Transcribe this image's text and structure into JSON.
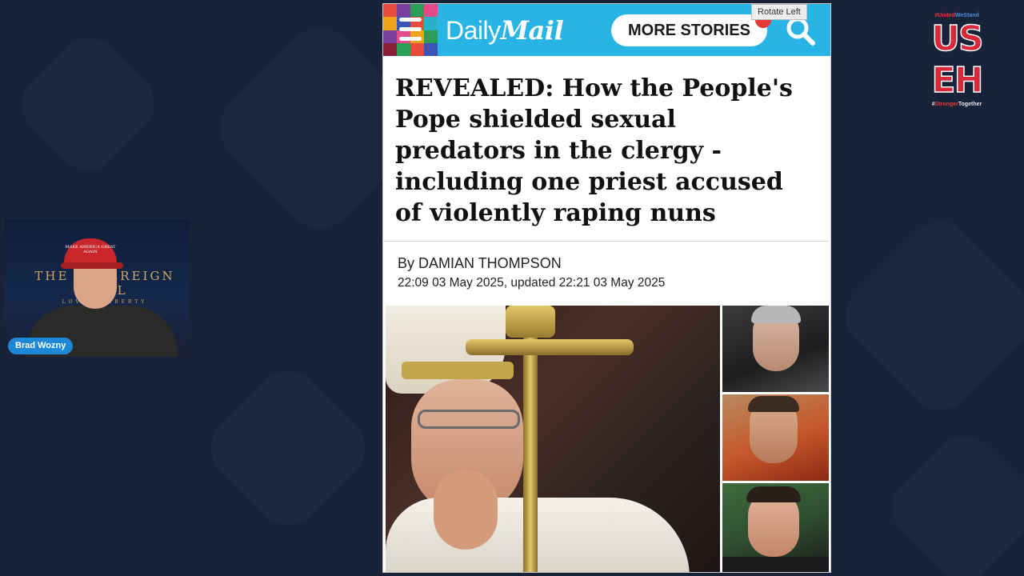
{
  "overlay": {
    "presenter_name": "Brad Wozny",
    "cam_logo": "THE SOVEREIGN SOUL",
    "cam_logo_sub": "LOVE · LIBERTY",
    "cap_text": "MAKE AMERICA GREAT AGAIN"
  },
  "tooltip": "Rotate Left",
  "header": {
    "logo_daily": "Daily",
    "logo_mail": "Mail",
    "more_stories": "MORE STORIES",
    "brand_color": "#29b4e6"
  },
  "article": {
    "headline": "REVEALED: How the People's Pope shielded sexual predators in the clergy - including one priest accused of violently raping nuns",
    "byline": "By DAMIAN THOMPSON",
    "dateline": "22:09 03 May 2025, updated 22:21 03 May 2025"
  },
  "brand": {
    "tag_top_a": "#United",
    "tag_top_b": "WeStand",
    "letters_top": "US",
    "letters_bottom": "EH",
    "tag_bottom_a": "#",
    "tag_bottom_b": "Stronger",
    "tag_bottom_c": "Together"
  },
  "icons": {
    "menu": "hamburger-icon",
    "search": "search-icon"
  }
}
